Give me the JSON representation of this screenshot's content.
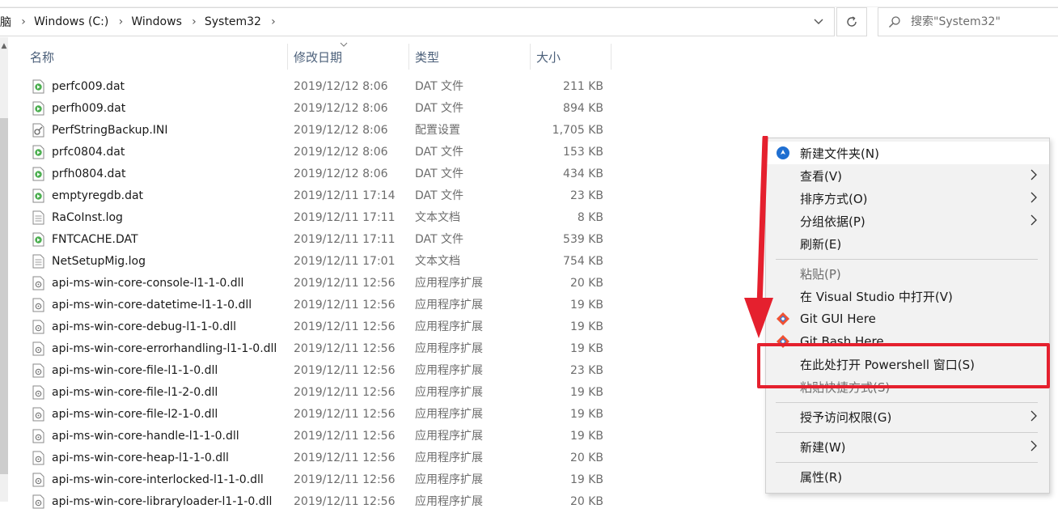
{
  "address": {
    "crumbs": [
      "脑",
      "Windows (C:)",
      "Windows",
      "System32"
    ],
    "separator": ">",
    "dropdown_icon": "chevron-down-icon",
    "refresh_icon": "refresh-icon"
  },
  "search": {
    "placeholder": "搜索\"System32\"",
    "icon": "search-icon"
  },
  "columns": {
    "name": "名称",
    "date": "修改日期",
    "type": "类型",
    "size": "大小"
  },
  "files": [
    {
      "name": "perfc009.dat",
      "date": "2019/12/12 8:06",
      "type": "DAT 文件",
      "size": "211 KB",
      "icon": "dat"
    },
    {
      "name": "perfh009.dat",
      "date": "2019/12/12 8:06",
      "type": "DAT 文件",
      "size": "894 KB",
      "icon": "dat"
    },
    {
      "name": "PerfStringBackup.INI",
      "date": "2019/12/12 8:06",
      "type": "配置设置",
      "size": "1,705 KB",
      "icon": "ini"
    },
    {
      "name": "prfc0804.dat",
      "date": "2019/12/12 8:06",
      "type": "DAT 文件",
      "size": "153 KB",
      "icon": "dat"
    },
    {
      "name": "prfh0804.dat",
      "date": "2019/12/12 8:06",
      "type": "DAT 文件",
      "size": "434 KB",
      "icon": "dat"
    },
    {
      "name": "emptyregdb.dat",
      "date": "2019/12/11 17:14",
      "type": "DAT 文件",
      "size": "23 KB",
      "icon": "dat"
    },
    {
      "name": "RaCoInst.log",
      "date": "2019/12/11 17:11",
      "type": "文本文档",
      "size": "8 KB",
      "icon": "txt"
    },
    {
      "name": "FNTCACHE.DAT",
      "date": "2019/12/11 17:11",
      "type": "DAT 文件",
      "size": "539 KB",
      "icon": "dat"
    },
    {
      "name": "NetSetupMig.log",
      "date": "2019/12/11 17:01",
      "type": "文本文档",
      "size": "754 KB",
      "icon": "txt"
    },
    {
      "name": "api-ms-win-core-console-l1-1-0.dll",
      "date": "2019/12/11 12:56",
      "type": "应用程序扩展",
      "size": "20 KB",
      "icon": "dll"
    },
    {
      "name": "api-ms-win-core-datetime-l1-1-0.dll",
      "date": "2019/12/11 12:56",
      "type": "应用程序扩展",
      "size": "19 KB",
      "icon": "dll"
    },
    {
      "name": "api-ms-win-core-debug-l1-1-0.dll",
      "date": "2019/12/11 12:56",
      "type": "应用程序扩展",
      "size": "19 KB",
      "icon": "dll"
    },
    {
      "name": "api-ms-win-core-errorhandling-l1-1-0.dll",
      "date": "2019/12/11 12:56",
      "type": "应用程序扩展",
      "size": "19 KB",
      "icon": "dll"
    },
    {
      "name": "api-ms-win-core-file-l1-1-0.dll",
      "date": "2019/12/11 12:56",
      "type": "应用程序扩展",
      "size": "23 KB",
      "icon": "dll"
    },
    {
      "name": "api-ms-win-core-file-l1-2-0.dll",
      "date": "2019/12/11 12:56",
      "type": "应用程序扩展",
      "size": "19 KB",
      "icon": "dll"
    },
    {
      "name": "api-ms-win-core-file-l2-1-0.dll",
      "date": "2019/12/11 12:56",
      "type": "应用程序扩展",
      "size": "19 KB",
      "icon": "dll"
    },
    {
      "name": "api-ms-win-core-handle-l1-1-0.dll",
      "date": "2019/12/11 12:56",
      "type": "应用程序扩展",
      "size": "19 KB",
      "icon": "dll"
    },
    {
      "name": "api-ms-win-core-heap-l1-1-0.dll",
      "date": "2019/12/11 12:56",
      "type": "应用程序扩展",
      "size": "20 KB",
      "icon": "dll"
    },
    {
      "name": "api-ms-win-core-interlocked-l1-1-0.dll",
      "date": "2019/12/11 12:56",
      "type": "应用程序扩展",
      "size": "19 KB",
      "icon": "dll"
    },
    {
      "name": "api-ms-win-core-libraryloader-l1-1-0.dll",
      "date": "2019/12/11 12:56",
      "type": "应用程序扩展",
      "size": "20 KB",
      "icon": "dll"
    }
  ],
  "context_menu": {
    "items": [
      {
        "label": "新建文件夹(N)",
        "icon": "new-folder-icon",
        "submenu": false,
        "disabled": false,
        "highlighted": true
      },
      {
        "label": "查看(V)",
        "submenu": true,
        "disabled": false
      },
      {
        "label": "排序方式(O)",
        "submenu": true,
        "disabled": false
      },
      {
        "label": "分组依据(P)",
        "submenu": true,
        "disabled": false
      },
      {
        "label": "刷新(E)",
        "submenu": false,
        "disabled": false
      },
      {
        "separator": true
      },
      {
        "label": "粘贴(P)",
        "submenu": false,
        "disabled": true
      },
      {
        "label": "在 Visual Studio 中打开(V)",
        "submenu": false,
        "disabled": false
      },
      {
        "label": "Git GUI Here",
        "icon": "git-icon",
        "submenu": false,
        "disabled": false
      },
      {
        "label": "Git Bash Here",
        "icon": "git-icon",
        "submenu": false,
        "disabled": false
      },
      {
        "label": "在此处打开 Powershell 窗口(S)",
        "submenu": false,
        "disabled": false
      },
      {
        "label": "粘贴快捷方式(S)",
        "submenu": false,
        "disabled": true
      },
      {
        "separator": true
      },
      {
        "label": "授予访问权限(G)",
        "submenu": true,
        "disabled": false
      },
      {
        "separator": true
      },
      {
        "label": "新建(W)",
        "submenu": true,
        "disabled": false
      },
      {
        "separator": true
      },
      {
        "label": "属性(R)",
        "submenu": false,
        "disabled": false
      }
    ]
  },
  "colors": {
    "annotation_red": "#e5202e",
    "header_text": "#4c607a",
    "menu_bg": "#f2f2f2"
  }
}
